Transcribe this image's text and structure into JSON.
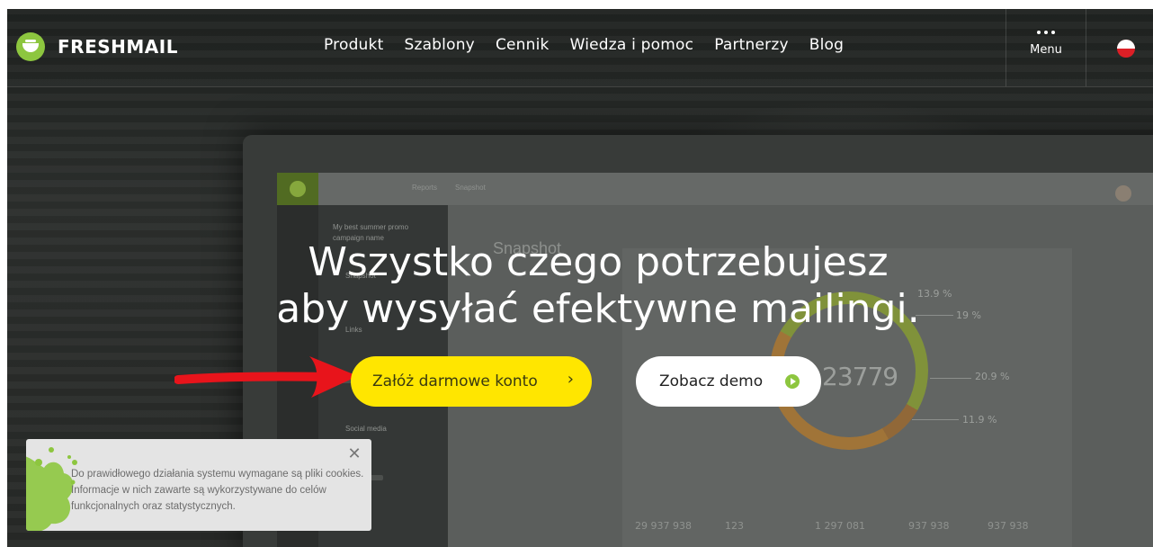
{
  "header": {
    "brand": "FRESHMAIL",
    "nav": [
      "Produkt",
      "Szablony",
      "Cennik",
      "Wiedza i pomoc",
      "Partnerzy",
      "Blog"
    ],
    "menu_label": "Menu",
    "language_flag": "flag-poland-icon"
  },
  "hero": {
    "title_line1": "Wszystko czego potrzebujesz",
    "title_line2": "aby wysyłać efektywne mailingi.",
    "primary_button": "Załóż darmowe konto",
    "primary_chevron": "›",
    "secondary_button": "Zobacz demo"
  },
  "background_app": {
    "breadcrumb": [
      "Reports",
      "Snapshot"
    ],
    "campaign_title": "My best summer promo",
    "campaign_subtitle": "campaign name",
    "menu_items": [
      "Snapshot",
      "Links",
      "Social media"
    ],
    "heading": "Snapshot",
    "total": "23779",
    "percents": [
      "13.9 %",
      "19 %",
      "20.9 %",
      "11.9 %"
    ],
    "stats": [
      "29 937 938",
      "123",
      "1 297 081",
      "937 938",
      "937 938"
    ]
  },
  "cookie": {
    "text": "Do prawidłowego działania systemu wymagane są pliki cookies. Informacje w nich zawarte są wykorzystywane do celów funkcjonalnych oraz statystycznych.",
    "close": "✕"
  },
  "colors": {
    "brand_green": "#8dc63f",
    "cta_yellow": "#ffe600",
    "annotation_red": "#e8141b"
  }
}
